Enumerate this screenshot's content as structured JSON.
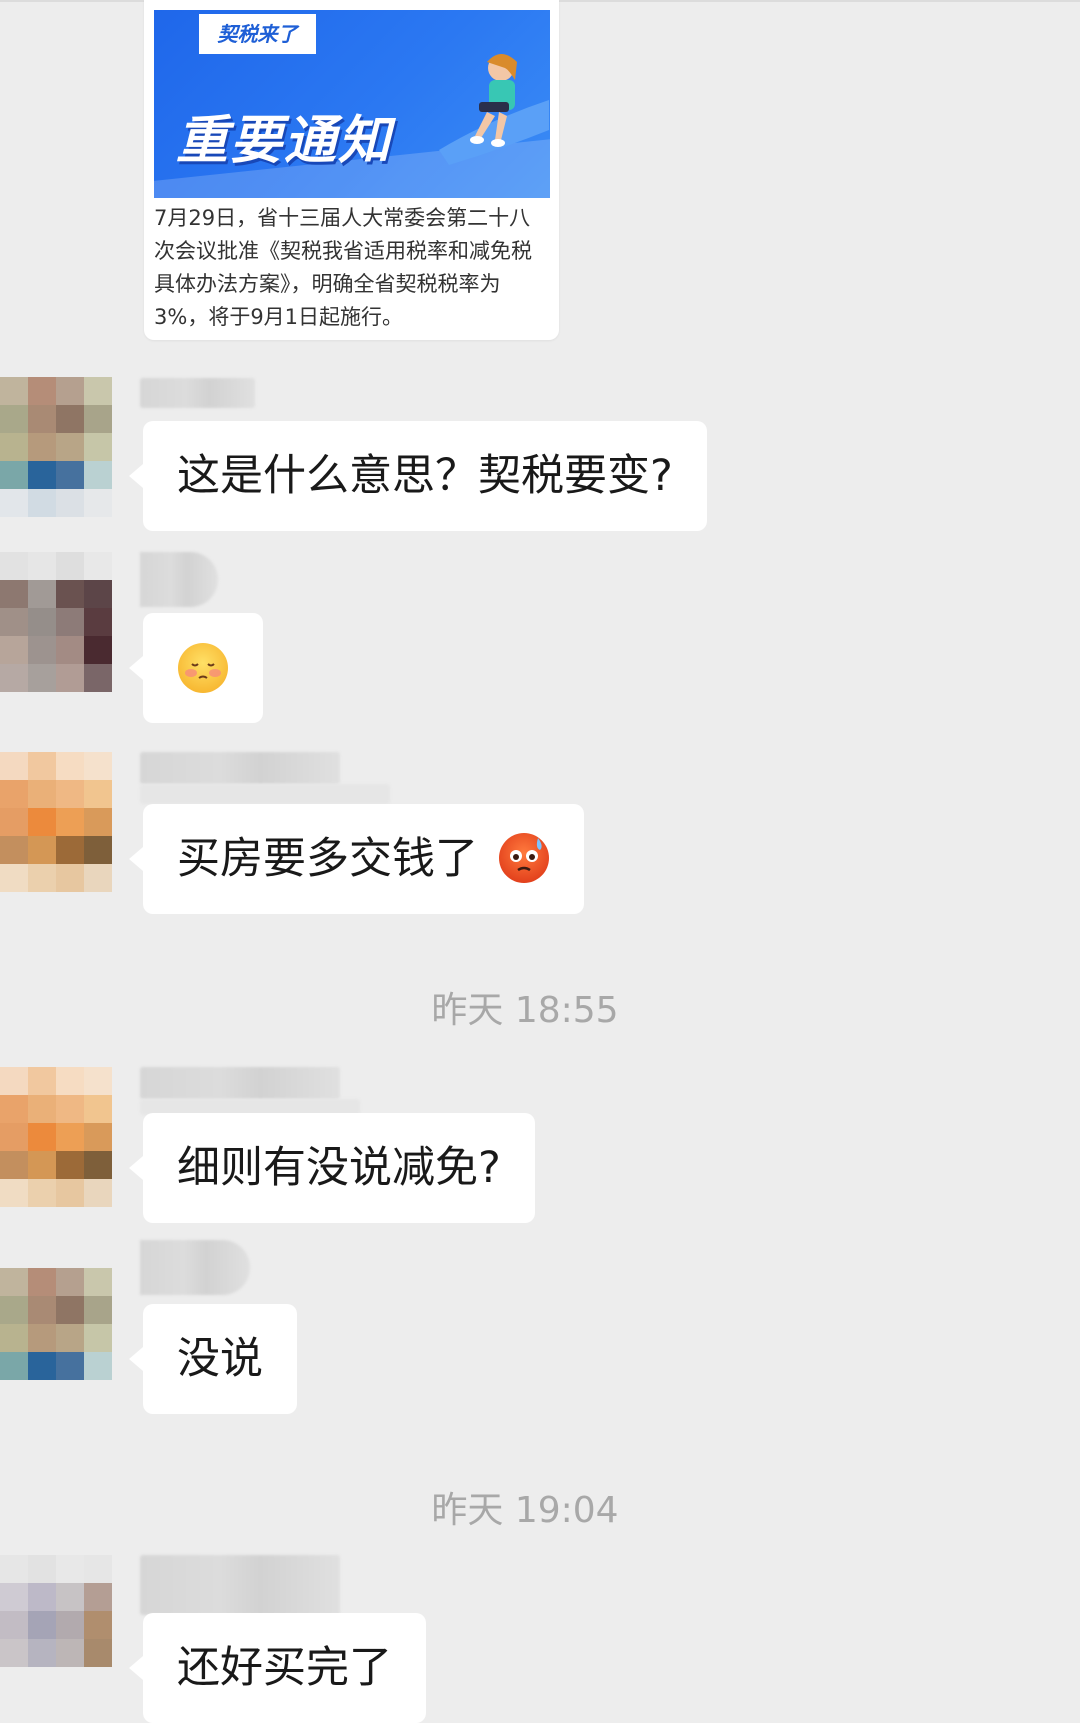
{
  "card": {
    "tag": "契税来了",
    "headline": "重要通知",
    "description": "7月29日，省十三届人大常委会第二十八次会议批准《契税我省适用税率和减免税具体办法方案》，明确全省契税税率为3%，将于9月1日起施行。"
  },
  "messages": [
    {
      "text": "这是什么意思？契税要变?"
    },
    {
      "emoji": "blushing-face-emoji"
    },
    {
      "text": "买房要多交钱了",
      "emoji": "angry-sweat-face-emoji"
    },
    {
      "text": "细则有没说减免?"
    },
    {
      "text": "没说"
    },
    {
      "text": "还好买完了"
    }
  ],
  "timestamps": [
    "昨天 18:55",
    "昨天 19:04"
  ]
}
